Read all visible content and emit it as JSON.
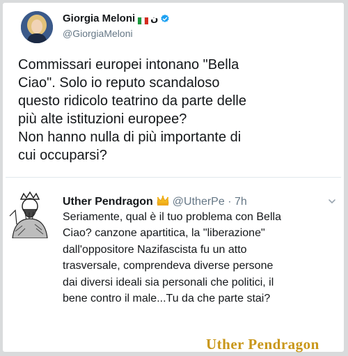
{
  "original_tweet": {
    "author_name": "Giorgia Meloni",
    "name_suffix": "ن",
    "flag_colors": [
      "#1a9a3e",
      "#ffffff",
      "#d52b1e"
    ],
    "handle": "@GiorgiaMeloni",
    "verified_color": "#1da1f2",
    "text_lines": [
      "Commissari europei intonano \"Bella",
      "Ciao\". Solo io reputo scandaloso",
      "questo ridicolo teatrino da parte delle",
      "più alte istituzioni europee?",
      "Non hanno nulla di più importante di",
      "cui occuparsi?"
    ]
  },
  "reply_tweet": {
    "author_name": "Uther Pendragon",
    "badge_icon": "crown-icon",
    "handle": "@UtherPe",
    "separator": "·",
    "time": "7h",
    "text_lines": [
      "Seriamente, qual è il tuo problema con Bella",
      "Ciao? canzone apartitica, la \"liberazione\"",
      "dall'oppositore Nazifascista fu un atto",
      "trasversale, comprendeva diverse persone",
      "dai diversi ideali sia personali che politici,  il",
      "bene contro il male...Tu da che parte stai?"
    ]
  },
  "watermark": {
    "text": "Uther Pendragon",
    "color": "#c9971a"
  }
}
